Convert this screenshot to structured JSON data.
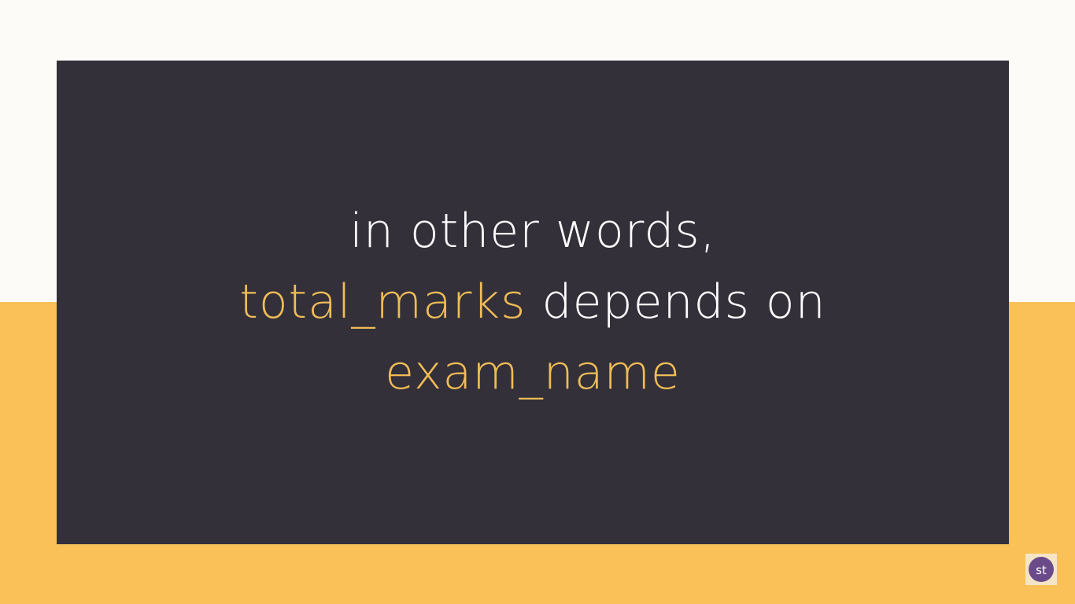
{
  "slide": {
    "line1": "in other words,",
    "line2_highlight": "total_marks",
    "line2_rest": " depends on",
    "line3_highlight": "exam_name"
  },
  "logo": {
    "text": "st"
  },
  "colors": {
    "panel": "#33303a",
    "accent": "#f0bc55",
    "background_top": "#fdfbf7",
    "background_bottom": "#f9c158"
  }
}
